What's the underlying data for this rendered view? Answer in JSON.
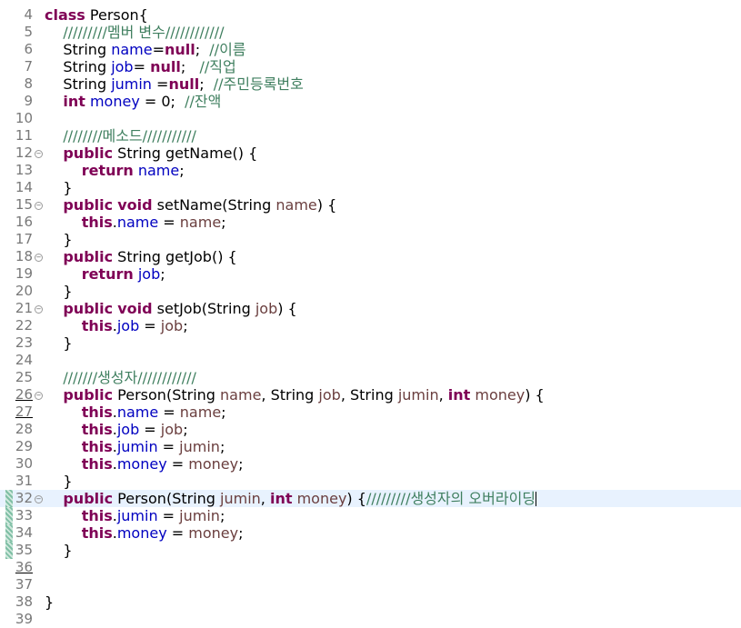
{
  "lines": [
    {
      "no": "4",
      "tokens": [
        [
          "kw",
          "class"
        ],
        [
          "p",
          " Person{"
        ]
      ]
    },
    {
      "no": "5",
      "tokens": [
        [
          "p",
          "    "
        ],
        [
          "cmt",
          "/////////멤버 변수////////////"
        ]
      ]
    },
    {
      "no": "6",
      "tokens": [
        [
          "p",
          "    String "
        ],
        [
          "fld",
          "name"
        ],
        [
          "p",
          "="
        ],
        [
          "kw",
          "null"
        ],
        [
          "p",
          ";  "
        ],
        [
          "cmt",
          "//이름"
        ]
      ]
    },
    {
      "no": "7",
      "tokens": [
        [
          "p",
          "    String "
        ],
        [
          "fld",
          "job"
        ],
        [
          "p",
          "= "
        ],
        [
          "kw",
          "null"
        ],
        [
          "p",
          ";   "
        ],
        [
          "cmt",
          "//직업"
        ]
      ]
    },
    {
      "no": "8",
      "tokens": [
        [
          "p",
          "    String "
        ],
        [
          "fld",
          "jumin"
        ],
        [
          "p",
          " ="
        ],
        [
          "kw",
          "null"
        ],
        [
          "p",
          ";  "
        ],
        [
          "cmt",
          "//주민등록번호"
        ]
      ]
    },
    {
      "no": "9",
      "tokens": [
        [
          "p",
          "    "
        ],
        [
          "kw",
          "int"
        ],
        [
          "p",
          " "
        ],
        [
          "fld",
          "money"
        ],
        [
          "p",
          " = 0;  "
        ],
        [
          "cmt",
          "//잔액"
        ]
      ]
    },
    {
      "no": "10",
      "tokens": []
    },
    {
      "no": "11",
      "tokens": [
        [
          "p",
          "    "
        ],
        [
          "cmt",
          "////////메소드///////////"
        ]
      ]
    },
    {
      "no": "12",
      "fold": true,
      "tokens": [
        [
          "p",
          "    "
        ],
        [
          "kw",
          "public"
        ],
        [
          "p",
          " String getName() {"
        ]
      ]
    },
    {
      "no": "13",
      "tokens": [
        [
          "p",
          "        "
        ],
        [
          "kw",
          "return"
        ],
        [
          "p",
          " "
        ],
        [
          "fld",
          "name"
        ],
        [
          "p",
          ";"
        ]
      ]
    },
    {
      "no": "14",
      "tokens": [
        [
          "p",
          "    }"
        ]
      ]
    },
    {
      "no": "15",
      "fold": true,
      "tokens": [
        [
          "p",
          "    "
        ],
        [
          "kw",
          "public"
        ],
        [
          "p",
          " "
        ],
        [
          "kw",
          "void"
        ],
        [
          "p",
          " setName(String "
        ],
        [
          "prm",
          "name"
        ],
        [
          "p",
          ") {"
        ]
      ]
    },
    {
      "no": "16",
      "tokens": [
        [
          "p",
          "        "
        ],
        [
          "kw",
          "this"
        ],
        [
          "p",
          "."
        ],
        [
          "fld",
          "name"
        ],
        [
          "p",
          " = "
        ],
        [
          "prm",
          "name"
        ],
        [
          "p",
          ";"
        ]
      ]
    },
    {
      "no": "17",
      "tokens": [
        [
          "p",
          "    }"
        ]
      ]
    },
    {
      "no": "18",
      "fold": true,
      "tokens": [
        [
          "p",
          "    "
        ],
        [
          "kw",
          "public"
        ],
        [
          "p",
          " String getJob() {"
        ]
      ]
    },
    {
      "no": "19",
      "tokens": [
        [
          "p",
          "        "
        ],
        [
          "kw",
          "return"
        ],
        [
          "p",
          " "
        ],
        [
          "fld",
          "job"
        ],
        [
          "p",
          ";"
        ]
      ]
    },
    {
      "no": "20",
      "tokens": [
        [
          "p",
          "    }"
        ]
      ]
    },
    {
      "no": "21",
      "fold": true,
      "tokens": [
        [
          "p",
          "    "
        ],
        [
          "kw",
          "public"
        ],
        [
          "p",
          " "
        ],
        [
          "kw",
          "void"
        ],
        [
          "p",
          " setJob(String "
        ],
        [
          "prm",
          "job"
        ],
        [
          "p",
          ") {"
        ]
      ]
    },
    {
      "no": "22",
      "tokens": [
        [
          "p",
          "        "
        ],
        [
          "kw",
          "this"
        ],
        [
          "p",
          "."
        ],
        [
          "fld",
          "job"
        ],
        [
          "p",
          " = "
        ],
        [
          "prm",
          "job"
        ],
        [
          "p",
          ";"
        ]
      ]
    },
    {
      "no": "23",
      "tokens": [
        [
          "p",
          "    }"
        ]
      ]
    },
    {
      "no": "24",
      "tokens": []
    },
    {
      "no": "25",
      "tokens": [
        [
          "p",
          "    "
        ],
        [
          "cmt",
          "///////생성자////////////"
        ]
      ]
    },
    {
      "no": "26",
      "fold": true,
      "tokens": [
        [
          "p",
          "    "
        ],
        [
          "kw",
          "public"
        ],
        [
          "p",
          " Person(String "
        ],
        [
          "prm",
          "name"
        ],
        [
          "p",
          ", String "
        ],
        [
          "prm",
          "job"
        ],
        [
          "p",
          ", String "
        ],
        [
          "prm",
          "jumin"
        ],
        [
          "p",
          ", "
        ],
        [
          "kw",
          "int"
        ],
        [
          "p",
          " "
        ],
        [
          "prm",
          "money"
        ],
        [
          "p",
          ") {"
        ]
      ]
    },
    {
      "no": "27",
      "tokens": [
        [
          "p",
          "        "
        ],
        [
          "kw",
          "this"
        ],
        [
          "p",
          "."
        ],
        [
          "fld",
          "name"
        ],
        [
          "p",
          " = "
        ],
        [
          "prm",
          "name"
        ],
        [
          "p",
          ";"
        ]
      ]
    },
    {
      "no": "28",
      "tokens": [
        [
          "p",
          "        "
        ],
        [
          "kw",
          "this"
        ],
        [
          "p",
          "."
        ],
        [
          "fld",
          "job"
        ],
        [
          "p",
          " = "
        ],
        [
          "prm",
          "job"
        ],
        [
          "p",
          ";"
        ]
      ]
    },
    {
      "no": "29",
      "tokens": [
        [
          "p",
          "        "
        ],
        [
          "kw",
          "this"
        ],
        [
          "p",
          "."
        ],
        [
          "fld",
          "jumin"
        ],
        [
          "p",
          " = "
        ],
        [
          "prm",
          "jumin"
        ],
        [
          "p",
          ";"
        ]
      ]
    },
    {
      "no": "30",
      "tokens": [
        [
          "p",
          "        "
        ],
        [
          "kw",
          "this"
        ],
        [
          "p",
          "."
        ],
        [
          "fld",
          "money"
        ],
        [
          "p",
          " = "
        ],
        [
          "prm",
          "money"
        ],
        [
          "p",
          ";"
        ]
      ]
    },
    {
      "no": "31",
      "tokens": [
        [
          "p",
          "    }"
        ]
      ]
    },
    {
      "no": "32",
      "fold": true,
      "current": true,
      "quickdiff": true,
      "caret": true,
      "tokens": [
        [
          "p",
          "    "
        ],
        [
          "kw",
          "public"
        ],
        [
          "p",
          " Person(String "
        ],
        [
          "prm",
          "jumin"
        ],
        [
          "p",
          ", "
        ],
        [
          "kw",
          "int"
        ],
        [
          "p",
          " "
        ],
        [
          "prm",
          "money"
        ],
        [
          "p",
          ") {"
        ],
        [
          "cmt",
          "/////////생성자의 오버라이딩"
        ]
      ]
    },
    {
      "no": "33",
      "quickdiff": true,
      "tokens": [
        [
          "p",
          "        "
        ],
        [
          "kw",
          "this"
        ],
        [
          "p",
          "."
        ],
        [
          "fld",
          "jumin"
        ],
        [
          "p",
          " = "
        ],
        [
          "prm",
          "jumin"
        ],
        [
          "p",
          ";"
        ]
      ]
    },
    {
      "no": "34",
      "quickdiff": true,
      "tokens": [
        [
          "p",
          "        "
        ],
        [
          "kw",
          "this"
        ],
        [
          "p",
          "."
        ],
        [
          "fld",
          "money"
        ],
        [
          "p",
          " = "
        ],
        [
          "prm",
          "money"
        ],
        [
          "p",
          ";"
        ]
      ]
    },
    {
      "no": "35",
      "quickdiff": true,
      "tokens": [
        [
          "p",
          "    }"
        ]
      ]
    },
    {
      "no": "36",
      "tokens": []
    },
    {
      "no": "37",
      "tokens": []
    },
    {
      "no": "38",
      "tokens": [
        [
          "p",
          "}"
        ]
      ]
    },
    {
      "no": "39",
      "tokens": []
    }
  ],
  "underlined_line_numbers": [
    "26",
    "27",
    "36"
  ],
  "colors": {
    "keyword": "#7f0055",
    "field": "#0000c0",
    "parameter": "#6a3e3e",
    "comment": "#3f7f5f",
    "current_line": "#e8f2fe"
  },
  "icons": {
    "fold": "fold-collapse-icon",
    "quickdiff": "quick-diff-marker"
  }
}
